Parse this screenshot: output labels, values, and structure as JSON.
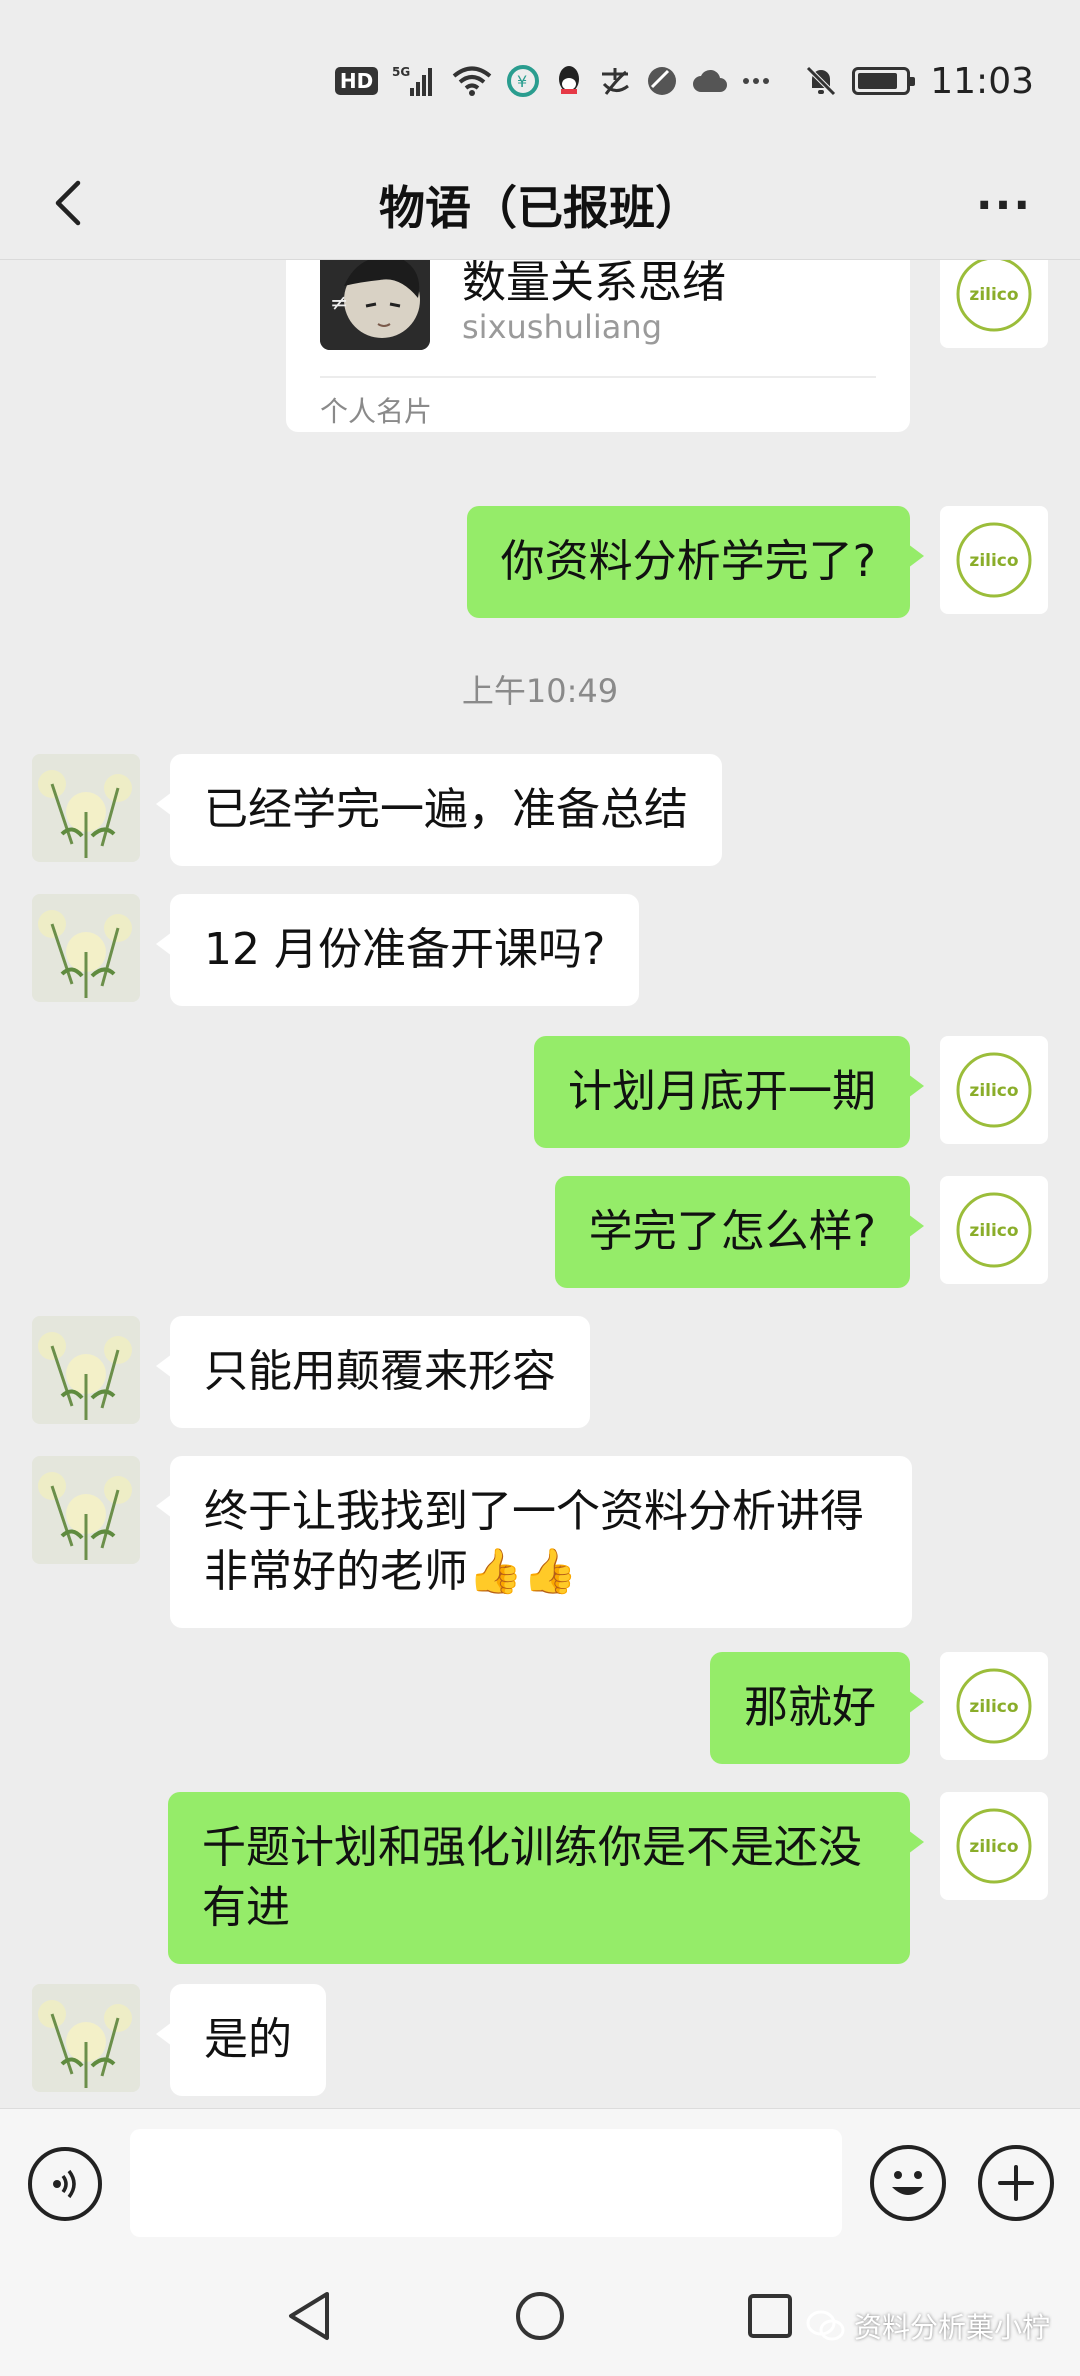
{
  "status_bar": {
    "hd": "HD",
    "network": "5G",
    "time": "11:03",
    "battery_fraction": 0.85,
    "icons": [
      "hd-icon",
      "signal-icon",
      "wifi-icon",
      "app-icon",
      "qq-icon",
      "alipay-icon",
      "app2-icon",
      "cloud-icon",
      "more-icon",
      "mute-icon",
      "battery-icon"
    ]
  },
  "header": {
    "title": "物语（已报班）",
    "more": "···"
  },
  "card": {
    "name": "数量关系思绪",
    "id": "sixushuliang",
    "footer": "个人名片"
  },
  "messages": [
    {
      "side": "sent",
      "text": "你资料分析学完了?"
    },
    {
      "timestamp": "上午10:49"
    },
    {
      "side": "recv",
      "text": "已经学完一遍，准备总结"
    },
    {
      "side": "recv",
      "text": "12 月份准备开课吗?"
    },
    {
      "side": "sent",
      "text": "计划月底开一期"
    },
    {
      "side": "sent",
      "text": "学完了怎么样?"
    },
    {
      "side": "recv",
      "text": "只能用颠覆来形容"
    },
    {
      "side": "recv",
      "text": "终于让我找到了一个资料分析讲得非常好的老师👍👍"
    },
    {
      "side": "sent",
      "text": "那就好"
    },
    {
      "side": "sent",
      "text": "千题计划和强化训练你是不是还没有进"
    },
    {
      "side": "recv",
      "text": "是的"
    }
  ],
  "self_avatar_text": "zilico",
  "input": {
    "placeholder": "",
    "value": ""
  },
  "watermark": "资料分析菓小柠",
  "colors": {
    "sent_bubble": "#95ec69",
    "recv_bubble": "#ffffff",
    "background": "#ededed"
  }
}
